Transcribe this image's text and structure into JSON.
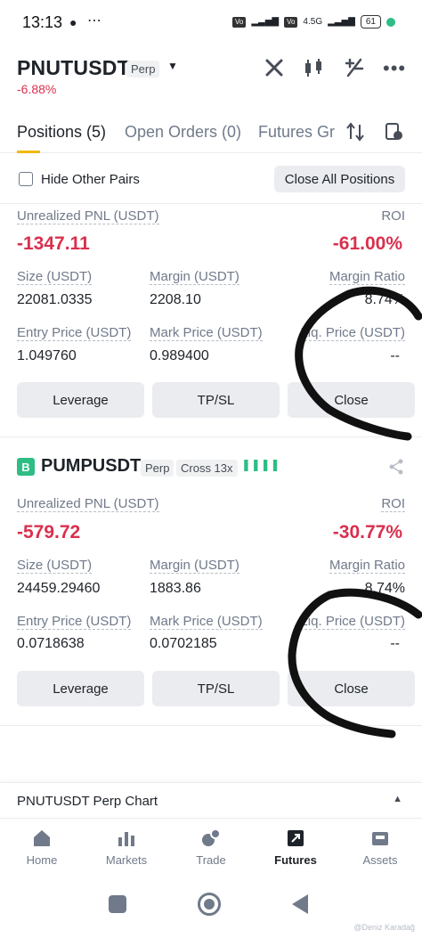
{
  "status_bar": {
    "time": "13:13",
    "network": "4.5G",
    "battery": "61"
  },
  "header": {
    "symbol": "PNUTUSDT",
    "type": "Perp",
    "change": "-6.88%"
  },
  "tabs": [
    {
      "label": "Positions (5)"
    },
    {
      "label": "Open Orders (0)"
    },
    {
      "label": "Futures Gr"
    }
  ],
  "filter": {
    "hide_other_pairs": "Hide Other Pairs",
    "close_all": "Close All Positions"
  },
  "positions": [
    {
      "pnl_label": "Unrealized PNL (USDT)",
      "pnl": "-1347.11",
      "roi_label": "ROI",
      "roi": "-61.00%",
      "size_label": "Size (USDT)",
      "size": "22081.0335",
      "margin_label": "Margin (USDT)",
      "margin": "2208.10",
      "margin_ratio_label": "Margin Ratio",
      "margin_ratio": "8.74%",
      "entry_label": "Entry Price (USDT)",
      "entry": "1.049760",
      "mark_label": "Mark Price (USDT)",
      "mark": "0.989400",
      "liq_label": "Liq. Price (USDT)",
      "liq": "--",
      "leverage_btn": "Leverage",
      "tpsl_btn": "TP/SL",
      "close_btn": "Close"
    },
    {
      "badge": "B",
      "symbol": "PUMPUSDT",
      "type": "Perp",
      "mode": "Cross 13x",
      "pnl_label": "Unrealized PNL (USDT)",
      "pnl": "-579.72",
      "roi_label": "ROI",
      "roi": "-30.77%",
      "size_label": "Size (USDT)",
      "size": "24459.29460",
      "margin_label": "Margin (USDT)",
      "margin": "1883.86",
      "margin_ratio_label": "Margin Ratio",
      "margin_ratio": "8.74%",
      "entry_label": "Entry Price (USDT)",
      "entry": "0.0718638",
      "mark_label": "Mark Price (USDT)",
      "mark": "0.0702185",
      "liq_label": "Liq. Price (USDT)",
      "liq": "--",
      "leverage_btn": "Leverage",
      "tpsl_btn": "TP/SL",
      "close_btn": "Close"
    }
  ],
  "chart_bar": {
    "label": "PNUTUSDT Perp Chart"
  },
  "bottom_nav": [
    {
      "label": "Home"
    },
    {
      "label": "Markets"
    },
    {
      "label": "Trade"
    },
    {
      "label": "Futures"
    },
    {
      "label": "Assets"
    }
  ],
  "watermark": "@Deniz Karadağ",
  "colors": {
    "negative": "#d9304e",
    "positive": "#2ebd85",
    "badge": "#2ebd85"
  }
}
